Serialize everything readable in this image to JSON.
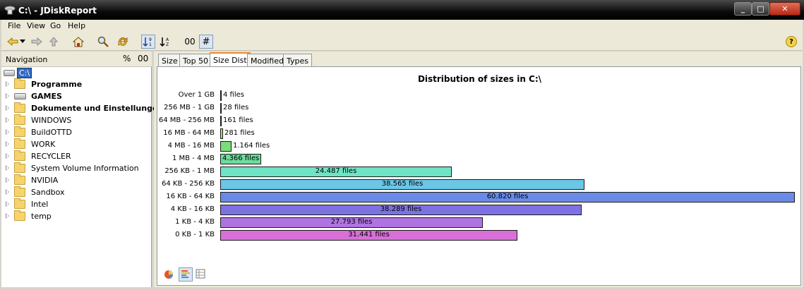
{
  "window": {
    "title": "C:\\ - JDiskReport"
  },
  "menu": [
    {
      "label": "File"
    },
    {
      "label": "View"
    },
    {
      "label": "Go"
    },
    {
      "label": "Help"
    }
  ],
  "toolbar": {
    "sort_toggle_label": "00",
    "hash_label": "#"
  },
  "navigation": {
    "title": "Navigation",
    "pct_label": "%",
    "count_label": "00",
    "root": "C:\\",
    "items": [
      {
        "label": "Programme",
        "bold": true,
        "icon": "folder-icon"
      },
      {
        "label": "GAMES",
        "bold": true,
        "icon": "drive-icon"
      },
      {
        "label": "Dokumente und Einstellungen",
        "bold": true,
        "icon": "folder-icon"
      },
      {
        "label": "WINDOWS",
        "bold": false,
        "icon": "folder-icon"
      },
      {
        "label": "BuildOTTD",
        "bold": false,
        "icon": "folder-icon"
      },
      {
        "label": "WORK",
        "bold": false,
        "icon": "folder-icon"
      },
      {
        "label": "RECYCLER",
        "bold": false,
        "icon": "folder-icon"
      },
      {
        "label": "System Volume Information",
        "bold": false,
        "icon": "folder-icon"
      },
      {
        "label": "NVIDIA",
        "bold": false,
        "icon": "folder-icon"
      },
      {
        "label": "Sandbox",
        "bold": false,
        "icon": "folder-icon"
      },
      {
        "label": "Intel",
        "bold": false,
        "icon": "folder-icon"
      },
      {
        "label": "temp",
        "bold": false,
        "icon": "folder-icon"
      }
    ]
  },
  "tabs": [
    {
      "label": "Size",
      "active": false
    },
    {
      "label": "Top 50",
      "active": false
    },
    {
      "label": "Size Dist",
      "active": true
    },
    {
      "label": "Modified",
      "active": false
    },
    {
      "label": "Types",
      "active": false
    }
  ],
  "chart_data": {
    "type": "bar",
    "orientation": "horizontal",
    "title": "Distribution of sizes in C:\\",
    "categories": [
      "Over 1 GB",
      "256 MB - 1 GB",
      "64 MB - 256 MB",
      "16 MB - 64 MB",
      "4 MB - 16 MB",
      "1 MB - 4 MB",
      "256 KB - 1 MB",
      "64 KB - 256 KB",
      "16 KB - 64 KB",
      "4 KB - 16 KB",
      "1 KB - 4 KB",
      "0 KB - 1 KB"
    ],
    "values": [
      4,
      28,
      161,
      281,
      1164,
      4366,
      24487,
      38565,
      60820,
      38289,
      27793,
      31441
    ],
    "value_labels": [
      "4 files",
      "28 files",
      "161 files",
      "281 files",
      "1.164 files",
      "4.366 files",
      "24.487 files",
      "38.565 files",
      "60.820 files",
      "38.289 files",
      "27.793 files",
      "31.441 files"
    ],
    "colors": [
      "#a4a4a4",
      "#b8b8a0",
      "#b8c47a",
      "#b0d870",
      "#7adc7a",
      "#6edc9c",
      "#6fe4c4",
      "#6cc6e6",
      "#6a8ae8",
      "#7e72e2",
      "#b074e2",
      "#d870d8"
    ]
  }
}
